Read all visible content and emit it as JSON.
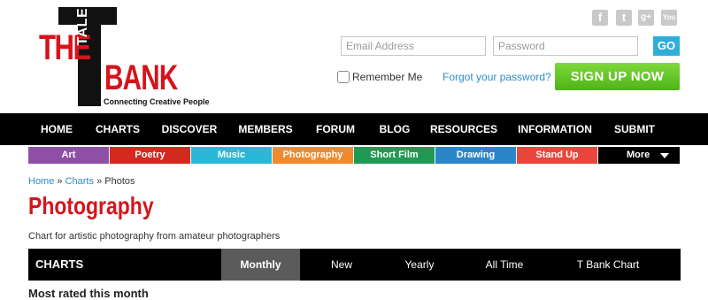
{
  "logo": {
    "word_the": "THE",
    "word_talent": "TALENT",
    "word_bank": "BANK",
    "tagline": "Connecting Creative People"
  },
  "social": [
    {
      "icon": "facebook-icon",
      "glyph": "f"
    },
    {
      "icon": "twitter-icon",
      "glyph": "t"
    },
    {
      "icon": "google-plus-icon",
      "glyph": "g+"
    },
    {
      "icon": "youtube-icon",
      "glyph": "You"
    }
  ],
  "login": {
    "email_placeholder": "Email Address",
    "password_placeholder": "Password",
    "go_label": "GO",
    "remember_label": "Remember Me",
    "forgot_label": "Forgot your password?",
    "signup_label": "SIGN UP NOW"
  },
  "main_nav": [
    "HOME",
    "CHARTS",
    "DISCOVER",
    "MEMBERS",
    "FORUM",
    "BLOG",
    "RESOURCES",
    "INFORMATION",
    "SUBMIT"
  ],
  "categories": [
    {
      "label": "Art",
      "color": "#8e4fa6"
    },
    {
      "label": "Poetry",
      "color": "#d42a1e"
    },
    {
      "label": "Music",
      "color": "#2bb8d8"
    },
    {
      "label": "Photography",
      "color": "#f28a2c"
    },
    {
      "label": "Short Film",
      "color": "#1f9a55"
    },
    {
      "label": "Drawing",
      "color": "#2a86c8"
    },
    {
      "label": "Stand Up",
      "color": "#e8463c"
    },
    {
      "label": "More",
      "color": "#000000"
    }
  ],
  "breadcrumb": {
    "home": "Home",
    "sep": "»",
    "charts": "Charts",
    "current": "Photos"
  },
  "page": {
    "title": "Photography",
    "subtitle": "Chart for artistic photography from amateur photographers"
  },
  "chart_tabs": {
    "heading": "CHARTS",
    "tabs": [
      "Monthly",
      "New",
      "Yearly",
      "All Time",
      "T Bank Chart"
    ],
    "active": "Monthly"
  },
  "next_heading": "Most rated this month"
}
